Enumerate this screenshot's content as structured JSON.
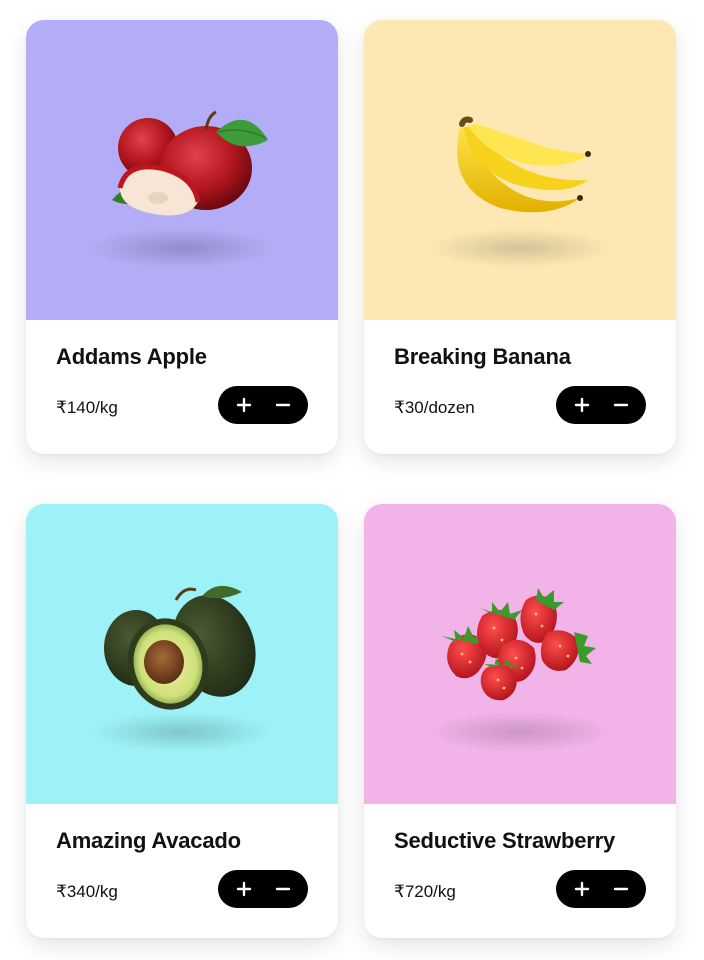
{
  "products": [
    {
      "name": "Addams Apple",
      "price": "₹140/kg",
      "bg_color": "#b3acf6",
      "icon": "apple-icon"
    },
    {
      "name": "Breaking Banana",
      "price": "₹30/dozen",
      "bg_color": "#fde8b4",
      "icon": "banana-icon"
    },
    {
      "name": "Amazing Avacado",
      "price": "₹340/kg",
      "bg_color": "#9cf2f6",
      "icon": "avocado-icon"
    },
    {
      "name": "Seductive Strawberry",
      "price": "₹720/kg",
      "bg_color": "#f2b3e8",
      "icon": "strawberry-icon"
    }
  ],
  "stepper": {
    "plus_icon": "plus-icon",
    "minus_icon": "minus-icon",
    "color": "#000000"
  }
}
